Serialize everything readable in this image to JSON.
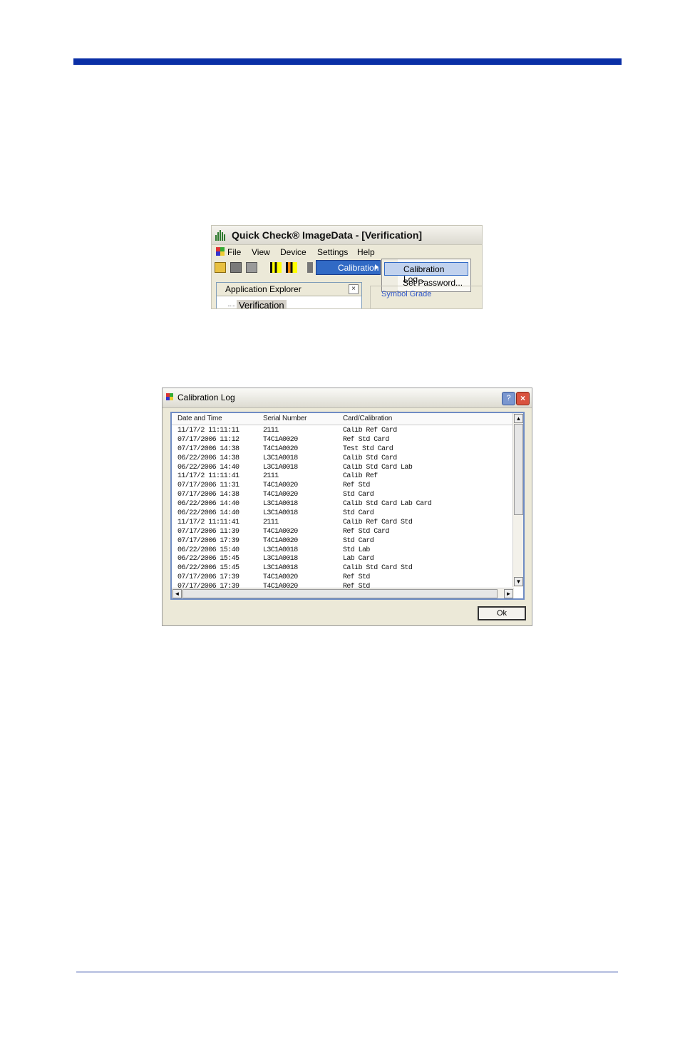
{
  "screenshot1": {
    "title": "Quick Check® ImageData - [Verification]",
    "menu": [
      "File",
      "View",
      "Device",
      "Settings",
      "Help"
    ],
    "settings_menu": {
      "calibration_label": "Calibration"
    },
    "calibration_submenu": [
      "Calibration Log...",
      "Set Password..."
    ],
    "panel": {
      "title": "Application Explorer",
      "close": "×",
      "tree_item": "Verification"
    },
    "symbol_grade_label": "Symbol Grade",
    "icons": [
      "app-logo-icon",
      "open-icon",
      "save-icon",
      "print-icon",
      "verify-icon",
      "verify-edit-icon"
    ]
  },
  "screenshot2": {
    "title": "Calibration Log",
    "help": "?",
    "close": "×",
    "columns": [
      "Date and Time",
      "Serial Number",
      "Card/Calibration"
    ],
    "rows": [
      [
        "11/17/2 11:11:11",
        "2111",
        "Calib Ref Card"
      ],
      [
        "07/17/2006 11:12",
        "T4C1A0020",
        "Ref Std Card"
      ],
      [
        "07/17/2006 14:38",
        "T4C1A0020",
        "Test Std Card"
      ],
      [
        "06/22/2006 14:38",
        "L3C1A0018",
        "Calib Std Card"
      ],
      [
        "06/22/2006 14:40",
        "L3C1A0018",
        "Calib Std Card Lab"
      ],
      [
        "11/17/2 11:11:41",
        "2111",
        "Calib Ref"
      ],
      [
        "07/17/2006 11:31",
        "T4C1A0020",
        "Ref Std"
      ],
      [
        "07/17/2006 14:38",
        "T4C1A0020",
        "Std Card"
      ],
      [
        "06/22/2006 14:40",
        "L3C1A0018",
        "Calib Std Card Lab Card"
      ],
      [
        "06/22/2006 14:40",
        "L3C1A0018",
        "Std Card"
      ],
      [
        "11/17/2 11:11:41",
        "2111",
        "Calib Ref Card Std"
      ],
      [
        "07/17/2006 11:39",
        "T4C1A0020",
        "Ref Std Card"
      ],
      [
        "07/17/2006 17:39",
        "T4C1A0020",
        "Std Card"
      ],
      [
        "06/22/2006 15:40",
        "L3C1A0018",
        "Std Lab"
      ],
      [
        "06/22/2006 15:45",
        "L3C1A0018",
        "Lab Card"
      ],
      [
        "06/22/2006 15:45",
        "L3C1A0018",
        "Calib Std Card Std"
      ],
      [
        "07/17/2006 17:39",
        "T4C1A0020",
        "Ref Std"
      ],
      [
        "07/17/2006 17:39",
        "T4C1A0020",
        "Ref Std"
      ]
    ],
    "ok_label": "Ok",
    "scroll": {
      "up": "▲",
      "down": "▼",
      "left": "◄",
      "right": "►"
    }
  },
  "colors": {
    "accent": "#0a2fa6",
    "menu_highlight": "#316ac5"
  }
}
